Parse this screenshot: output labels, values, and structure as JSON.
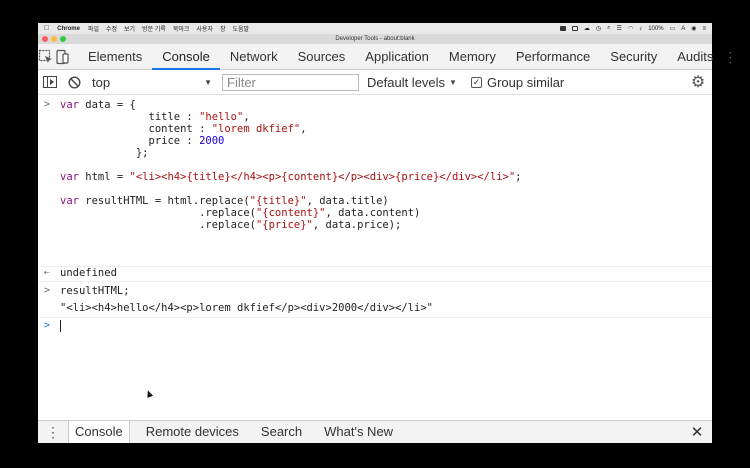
{
  "menubar": {
    "app": "Chrome",
    "items": [
      "파일",
      "수정",
      "보기",
      "방문 기록",
      "북마크",
      "사용자",
      "창",
      "도움말"
    ],
    "battery": "100%",
    "input": "A"
  },
  "window": {
    "title": "Developer Tools - about:blank"
  },
  "tabs": [
    "Elements",
    "Console",
    "Network",
    "Sources",
    "Application",
    "Memory",
    "Performance",
    "Security",
    "Audits"
  ],
  "toolbar": {
    "context": "top",
    "filter_placeholder": "Filter",
    "levels": "Default levels",
    "group_similar": "Group similar"
  },
  "console": {
    "input1": {
      "l1a": "var",
      "l1b": " data = {",
      "l2a": "              title : ",
      "l2b": "\"hello\"",
      "l2c": ",",
      "l3a": "              content : ",
      "l3b": "\"lorem dkfief\"",
      "l3c": ",",
      "l4a": "              price : ",
      "l4b": "2000",
      "l5": "            };",
      "l7a": "var",
      "l7b": " html = ",
      "l7c": "\"<li><h4>{title}</h4><p>{content}</p><div>{price}</div></li>\"",
      "l7d": ";",
      "l9a": "var",
      "l9b": " resultHTML = html.replace(",
      "l9c": "\"{title}\"",
      "l9d": ", data.title)",
      "l10a": "                      .replace(",
      "l10b": "\"{content}\"",
      "l10c": ", data.content)",
      "l11a": "                      .replace(",
      "l11b": "\"{price}\"",
      "l11c": ", data.price);"
    },
    "output1": "undefined",
    "input2": "resultHTML;",
    "output2": "\"<li><h4>hello</h4><p>lorem dkfief</p><div>2000</div></li>\""
  },
  "drawer": {
    "tabs": [
      "Console",
      "Remote devices",
      "Search",
      "What's New"
    ]
  },
  "colors": {
    "accent": "#1a73e8",
    "string": "#aa1111",
    "number": "#1c00cf",
    "keyword": "#881280"
  }
}
